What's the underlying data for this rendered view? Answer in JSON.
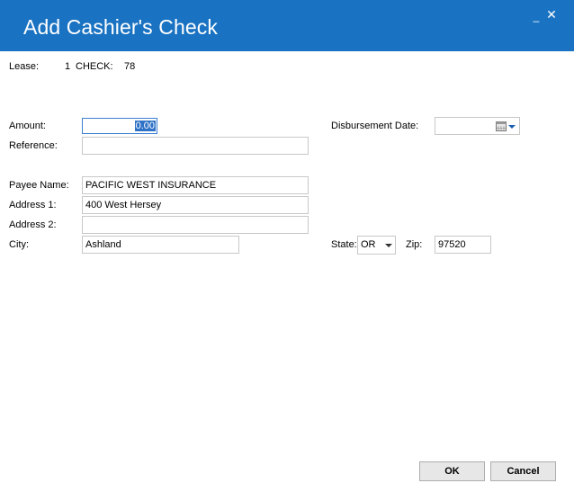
{
  "window": {
    "title": "Add Cashier's Check",
    "minimize_icon": "_",
    "close_icon": "✕"
  },
  "header": {
    "lease_label": "Lease:",
    "lease_value": "1",
    "check_label": "CHECK:",
    "check_value": "78"
  },
  "form": {
    "amount_label": "Amount:",
    "amount_value": "0.00",
    "reference_label": "Reference:",
    "reference_value": "",
    "disbursement_date_label": "Disbursement Date:",
    "disbursement_date_value": "",
    "payee_name_label": "Payee Name:",
    "payee_name_value": "PACIFIC WEST INSURANCE",
    "address1_label": "Address 1:",
    "address1_value": "400 West Hersey",
    "address2_label": "Address 2:",
    "address2_value": "",
    "city_label": "City:",
    "city_value": "Ashland",
    "state_label": "State:",
    "state_value": "OR",
    "zip_label": "Zip:",
    "zip_value": "97520"
  },
  "buttons": {
    "ok_label": "OK",
    "cancel_label": "Cancel"
  },
  "icons": {
    "calendar": "calendar-icon",
    "dropdown_arrow": "chevron-down-icon"
  },
  "colors": {
    "titlebar": "#1a73c2",
    "selection": "#3072c6"
  }
}
